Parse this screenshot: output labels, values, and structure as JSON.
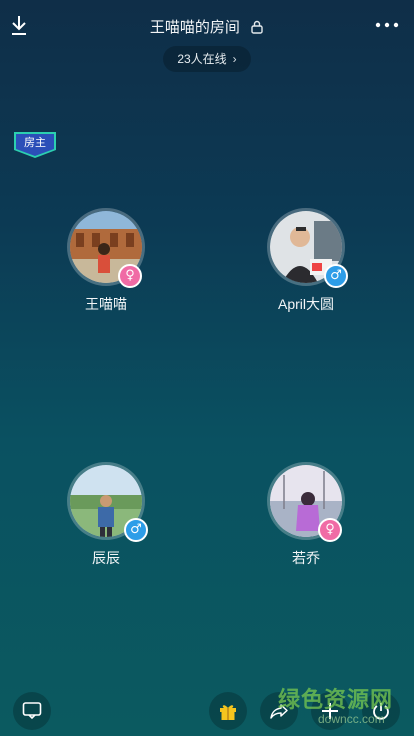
{
  "header": {
    "room_title": "王喵喵的房间",
    "online_count_text": "23人在线"
  },
  "host_badge_label": "房主",
  "seats": [
    {
      "name": "王喵喵",
      "gender": "female",
      "gender_icon": "female-symbol"
    },
    {
      "name": "April大圆",
      "gender": "male",
      "gender_icon": "male-symbol"
    },
    {
      "name": "辰辰",
      "gender": "male",
      "gender_icon": "male-symbol"
    },
    {
      "name": "若乔",
      "gender": "female",
      "gender_icon": "female-symbol"
    }
  ],
  "bottom_bar": {
    "icons": [
      "chat-icon",
      "gift-icon",
      "share-icon",
      "add-icon",
      "power-icon"
    ]
  },
  "watermark": {
    "line1": "绿色资源网",
    "line2": "downcc.com"
  },
  "colors": {
    "female": "#f06ba5",
    "male": "#2d9de8",
    "gift": "#f5c51e"
  }
}
